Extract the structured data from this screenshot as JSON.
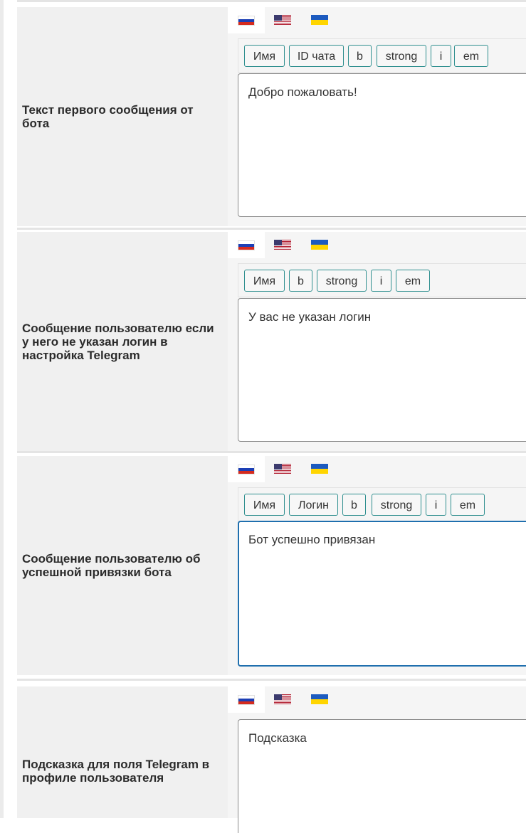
{
  "flags": {
    "ru": "flag-ru-icon",
    "us": "flag-us-icon",
    "ua": "flag-ua-icon"
  },
  "colors": {
    "accent_border": "#2f8f8f",
    "focus_border": "#1f6fae",
    "label_bg": "#f0f0f0"
  },
  "sections": [
    {
      "label": "Текст первого сообщения от бота",
      "buttons": [
        "Имя",
        "ID чата",
        "b",
        "strong",
        "i",
        "em"
      ],
      "value": "Добро пожаловать!"
    },
    {
      "label": "Сообщение пользователю если у него не указан логин в настройка Telegram",
      "buttons": [
        "Имя",
        "b",
        "strong",
        "i",
        "em"
      ],
      "value": "У вас не указан логин"
    },
    {
      "label": "Сообщение пользователю об успешной привязки бота",
      "buttons": [
        "Имя",
        "Логин",
        "b",
        "strong",
        "i",
        "em"
      ],
      "value": "Бот успешно привязан"
    },
    {
      "label": "Подсказка для поля Telegram в профиле пользователя",
      "buttons": [],
      "value": "Подсказка"
    }
  ]
}
